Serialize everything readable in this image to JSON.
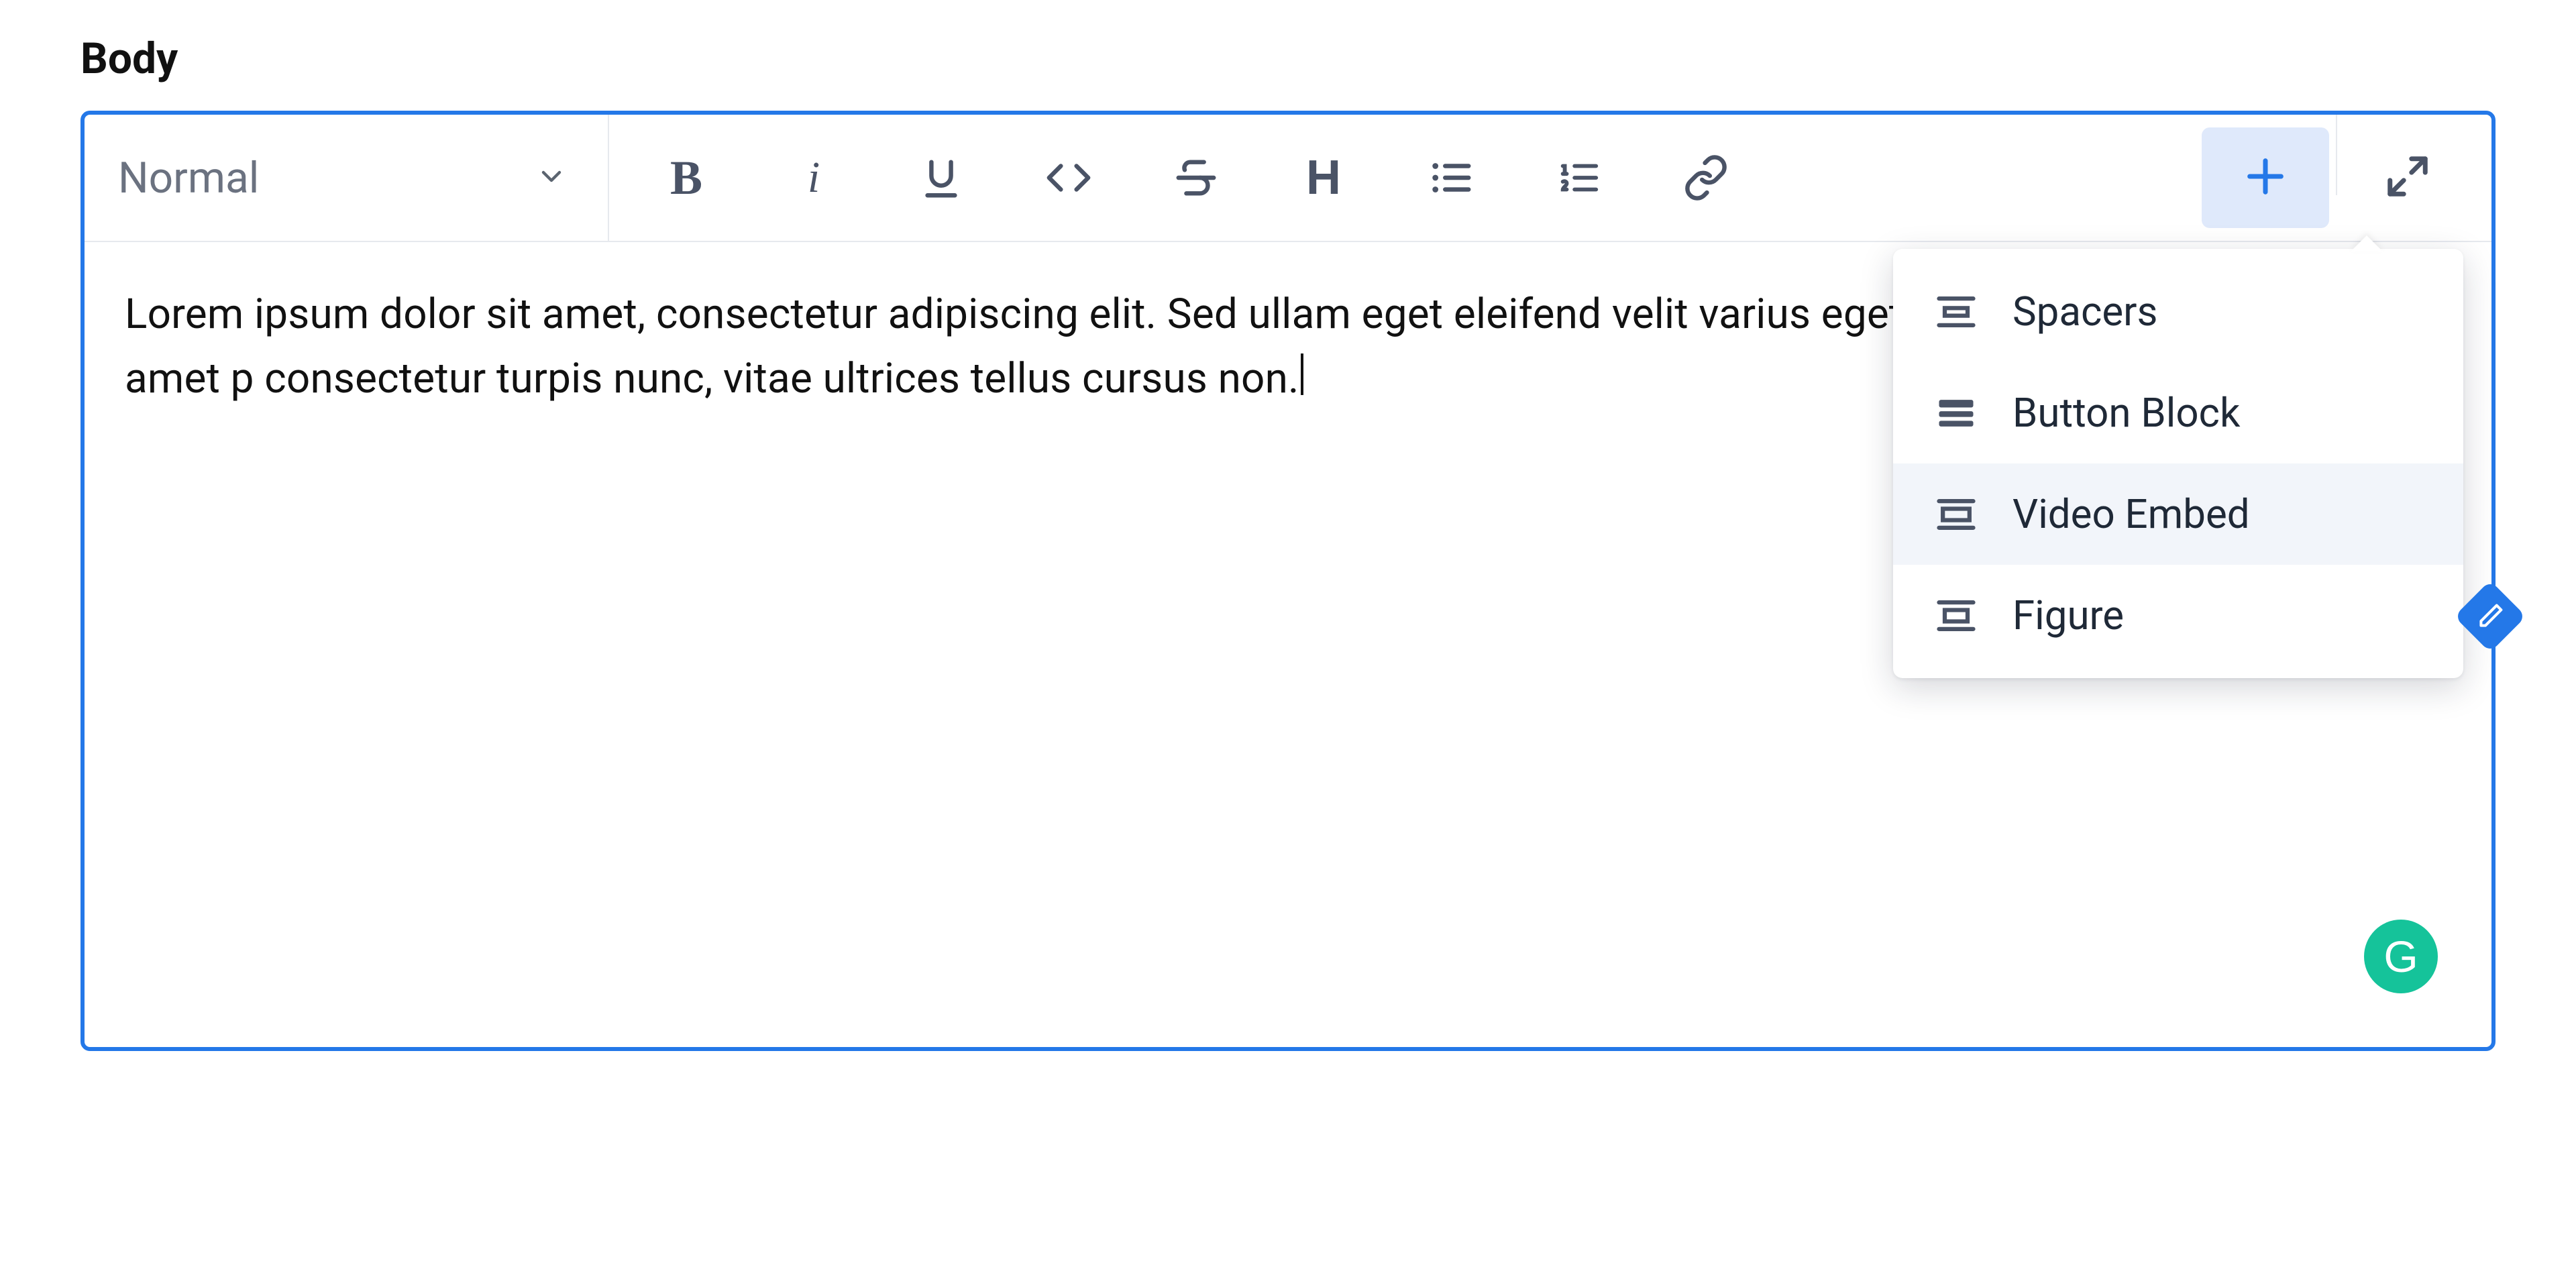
{
  "field_label": "Body",
  "toolbar": {
    "style_select": {
      "label": "Normal"
    }
  },
  "content": {
    "text": "Lorem ipsum dolor sit amet, consectetur adipiscing elit. Sed ullam eget eleifend velit varius eget. Duis congue sagittis orci sit amet p consectetur turpis nunc, vitae ultrices tellus cursus non."
  },
  "add_menu": {
    "items": [
      {
        "label": "Spacers"
      },
      {
        "label": "Button Block"
      },
      {
        "label": "Video Embed"
      },
      {
        "label": "Figure"
      }
    ]
  },
  "grammarly_badge": "G",
  "colors": {
    "accent": "#2478e8",
    "toolbar_icon": "#4a5366",
    "success": "#15c39a"
  }
}
